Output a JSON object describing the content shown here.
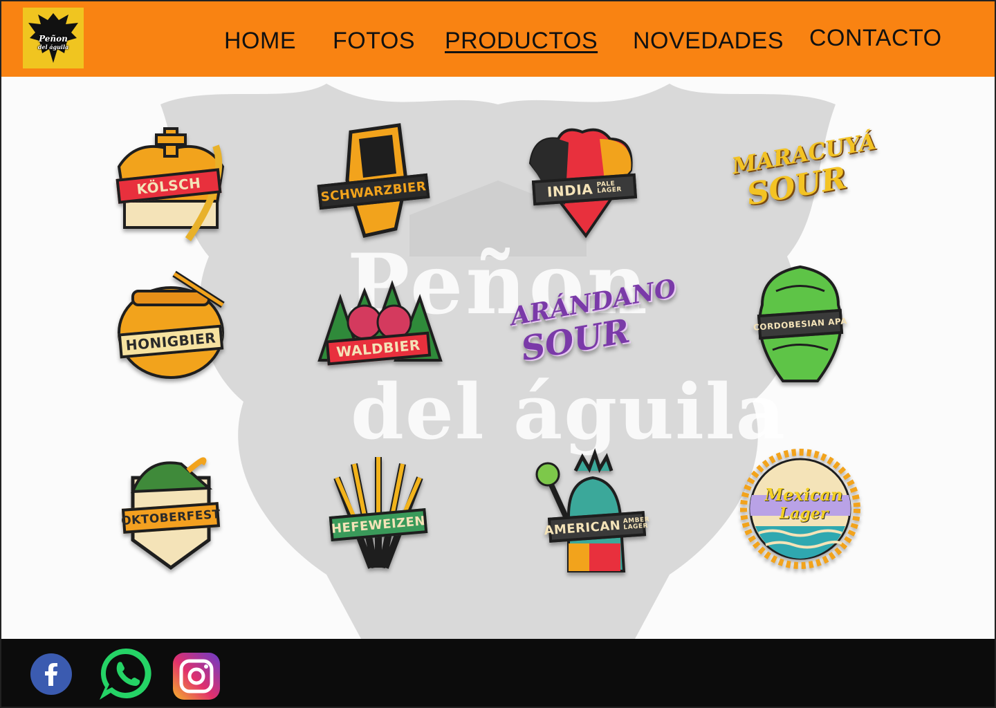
{
  "brand": {
    "logo_line1": "Peñon",
    "logo_line2": "del águila",
    "colors": {
      "header": "#f98312",
      "footer": "#0c0c0c",
      "logo_bg": "#f0c520"
    }
  },
  "nav": {
    "items": [
      {
        "label": "HOME",
        "active": false
      },
      {
        "label": "FOTOS",
        "active": false
      },
      {
        "label": "PRODUCTOS",
        "active": true
      },
      {
        "label": "NOVEDADES",
        "active": false
      },
      {
        "label": "CONTACTO",
        "active": false
      }
    ]
  },
  "background": {
    "watermark_line1": "Peñon",
    "watermark_line2": "del águila"
  },
  "products": [
    {
      "name": "KÖLSCH",
      "icon": "crown-wheat-icon",
      "banner_color": "#e8303d"
    },
    {
      "name": "SCHWARZBIER",
      "icon": "fist-icon",
      "banner_color": "#2a2a2a"
    },
    {
      "name": "INDIA",
      "sub": "PALE LAGER",
      "icon": "hops-tricolor-icon",
      "banner_color": "#3a3a3a"
    },
    {
      "name": "MARACUYÁ",
      "sub": "SOUR",
      "icon": "script-title-icon",
      "banner_color": "#f3c324"
    },
    {
      "name": "HONIGBIER",
      "icon": "honey-pot-icon",
      "banner_color": "#f6e2a0"
    },
    {
      "name": "WALDBIER",
      "icon": "forest-berries-icon",
      "banner_color": "#e8303d"
    },
    {
      "name": "ARÁNDANO",
      "sub": "SOUR",
      "icon": "script-title-icon",
      "banner_color": "#7a3aa8"
    },
    {
      "name": "CORDOBESIAN APA",
      "icon": "hop-cone-icon",
      "banner_color": "#3a3a3a"
    },
    {
      "name": "OKTOBERFEST",
      "icon": "alpine-hat-icon",
      "banner_color": "#f3a020"
    },
    {
      "name": "HEFEWEIZEN",
      "icon": "wheat-bundle-icon",
      "banner_color": "#3a9a5a"
    },
    {
      "name": "AMERICAN",
      "sub": "AMBER LAGER",
      "icon": "liberty-statue-icon",
      "banner_color": "#3a3a3a"
    },
    {
      "name": "Mexican",
      "sub": "Lager",
      "icon": "sun-waves-icon",
      "banner_color": "#b9a2e6"
    }
  ],
  "footer": {
    "social": [
      {
        "name": "facebook-icon",
        "color": "#3b5bb0"
      },
      {
        "name": "whatsapp-icon",
        "color": "#25d366"
      },
      {
        "name": "instagram-icon",
        "color": "#d6297a"
      }
    ]
  }
}
